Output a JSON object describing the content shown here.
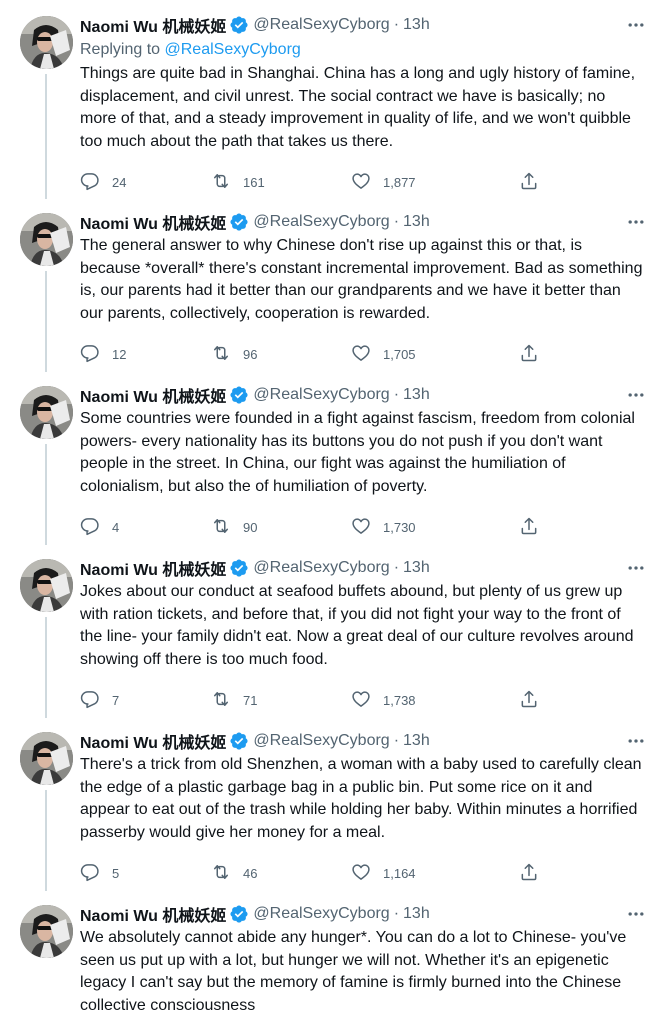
{
  "tweets": [
    {
      "name": "Naomi Wu 机械妖姬",
      "handle": "@RealSexyCyborg",
      "time": "13h",
      "replying_prefix": "Replying to ",
      "replying_handle": "@RealSexyCyborg",
      "text": "Things are quite bad in Shanghai. China has a long and ugly history of famine, displacement, and civil unrest. The social contract we have is basically; no more of that, and a steady improvement in quality of life, and we won't quibble too much about the path that takes us there.",
      "replies": "24",
      "retweets": "161",
      "likes": "1,877"
    },
    {
      "name": "Naomi Wu 机械妖姬",
      "handle": "@RealSexyCyborg",
      "time": "13h",
      "text": "The general answer to why Chinese don't rise up against this or that, is because *overall* there's constant incremental improvement. Bad as something is, our parents had it better than our grandparents and we have it better than our parents, collectively, cooperation is rewarded.",
      "replies": "12",
      "retweets": "96",
      "likes": "1,705"
    },
    {
      "name": "Naomi Wu 机械妖姬",
      "handle": "@RealSexyCyborg",
      "time": "13h",
      "text": "Some countries were founded in a fight against fascism, freedom from colonial powers- every nationality has its buttons you do not push if you don't want people in the street. In China, our fight was against the humiliation of colonialism, but also the of humiliation of poverty.",
      "replies": "4",
      "retweets": "90",
      "likes": "1,730"
    },
    {
      "name": "Naomi Wu 机械妖姬",
      "handle": "@RealSexyCyborg",
      "time": "13h",
      "text": "Jokes about our conduct at seafood buffets abound, but plenty of us grew up with ration tickets, and before that, if you did not fight your way to the front of the line- your family didn't eat. Now a great deal of our culture revolves around showing off there is too much food.",
      "replies": "7",
      "retweets": "71",
      "likes": "1,738"
    },
    {
      "name": "Naomi Wu 机械妖姬",
      "handle": "@RealSexyCyborg",
      "time": "13h",
      "text": "There's a trick from old Shenzhen, a woman with a baby used to carefully clean the edge of a plastic garbage bag in a public bin. Put some rice on it and appear to eat out of the trash while holding her baby. Within minutes a horrified passerby would give her money for a meal.",
      "replies": "5",
      "retweets": "46",
      "likes": "1,164"
    },
    {
      "name": "Naomi Wu 机械妖姬",
      "handle": "@RealSexyCyborg",
      "time": "13h",
      "text": "We absolutely cannot abide any hunger*. You can do a lot to Chinese- you've seen us put up with a lot, but hunger we will not. Whether it's an epigenetic legacy I can't say but the memory of famine is firmly burned into the Chinese collective consciousness"
    }
  ],
  "separator": "·",
  "icons": {
    "verified": "verified-badge-icon",
    "more": "more-dots-icon",
    "reply": "reply-icon",
    "retweet": "retweet-icon",
    "like": "heart-icon",
    "share": "share-icon",
    "accent": "#1d9bf0",
    "muted": "#536471"
  }
}
